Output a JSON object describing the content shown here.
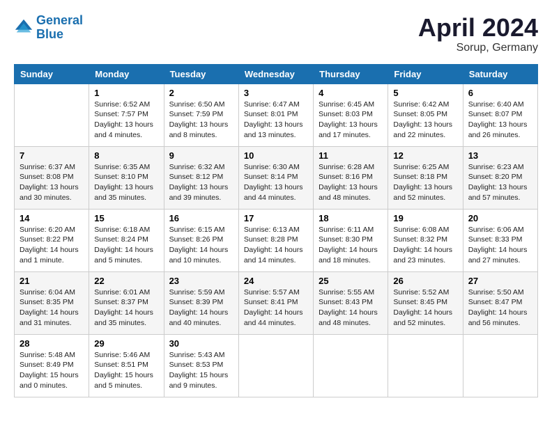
{
  "header": {
    "logo_line1": "General",
    "logo_line2": "Blue",
    "month_year": "April 2024",
    "location": "Sorup, Germany"
  },
  "days_of_week": [
    "Sunday",
    "Monday",
    "Tuesday",
    "Wednesday",
    "Thursday",
    "Friday",
    "Saturday"
  ],
  "weeks": [
    [
      {
        "day": "",
        "info": ""
      },
      {
        "day": "1",
        "info": "Sunrise: 6:52 AM\nSunset: 7:57 PM\nDaylight: 13 hours\nand 4 minutes."
      },
      {
        "day": "2",
        "info": "Sunrise: 6:50 AM\nSunset: 7:59 PM\nDaylight: 13 hours\nand 8 minutes."
      },
      {
        "day": "3",
        "info": "Sunrise: 6:47 AM\nSunset: 8:01 PM\nDaylight: 13 hours\nand 13 minutes."
      },
      {
        "day": "4",
        "info": "Sunrise: 6:45 AM\nSunset: 8:03 PM\nDaylight: 13 hours\nand 17 minutes."
      },
      {
        "day": "5",
        "info": "Sunrise: 6:42 AM\nSunset: 8:05 PM\nDaylight: 13 hours\nand 22 minutes."
      },
      {
        "day": "6",
        "info": "Sunrise: 6:40 AM\nSunset: 8:07 PM\nDaylight: 13 hours\nand 26 minutes."
      }
    ],
    [
      {
        "day": "7",
        "info": "Sunrise: 6:37 AM\nSunset: 8:08 PM\nDaylight: 13 hours\nand 30 minutes."
      },
      {
        "day": "8",
        "info": "Sunrise: 6:35 AM\nSunset: 8:10 PM\nDaylight: 13 hours\nand 35 minutes."
      },
      {
        "day": "9",
        "info": "Sunrise: 6:32 AM\nSunset: 8:12 PM\nDaylight: 13 hours\nand 39 minutes."
      },
      {
        "day": "10",
        "info": "Sunrise: 6:30 AM\nSunset: 8:14 PM\nDaylight: 13 hours\nand 44 minutes."
      },
      {
        "day": "11",
        "info": "Sunrise: 6:28 AM\nSunset: 8:16 PM\nDaylight: 13 hours\nand 48 minutes."
      },
      {
        "day": "12",
        "info": "Sunrise: 6:25 AM\nSunset: 8:18 PM\nDaylight: 13 hours\nand 52 minutes."
      },
      {
        "day": "13",
        "info": "Sunrise: 6:23 AM\nSunset: 8:20 PM\nDaylight: 13 hours\nand 57 minutes."
      }
    ],
    [
      {
        "day": "14",
        "info": "Sunrise: 6:20 AM\nSunset: 8:22 PM\nDaylight: 14 hours\nand 1 minute."
      },
      {
        "day": "15",
        "info": "Sunrise: 6:18 AM\nSunset: 8:24 PM\nDaylight: 14 hours\nand 5 minutes."
      },
      {
        "day": "16",
        "info": "Sunrise: 6:15 AM\nSunset: 8:26 PM\nDaylight: 14 hours\nand 10 minutes."
      },
      {
        "day": "17",
        "info": "Sunrise: 6:13 AM\nSunset: 8:28 PM\nDaylight: 14 hours\nand 14 minutes."
      },
      {
        "day": "18",
        "info": "Sunrise: 6:11 AM\nSunset: 8:30 PM\nDaylight: 14 hours\nand 18 minutes."
      },
      {
        "day": "19",
        "info": "Sunrise: 6:08 AM\nSunset: 8:32 PM\nDaylight: 14 hours\nand 23 minutes."
      },
      {
        "day": "20",
        "info": "Sunrise: 6:06 AM\nSunset: 8:33 PM\nDaylight: 14 hours\nand 27 minutes."
      }
    ],
    [
      {
        "day": "21",
        "info": "Sunrise: 6:04 AM\nSunset: 8:35 PM\nDaylight: 14 hours\nand 31 minutes."
      },
      {
        "day": "22",
        "info": "Sunrise: 6:01 AM\nSunset: 8:37 PM\nDaylight: 14 hours\nand 35 minutes."
      },
      {
        "day": "23",
        "info": "Sunrise: 5:59 AM\nSunset: 8:39 PM\nDaylight: 14 hours\nand 40 minutes."
      },
      {
        "day": "24",
        "info": "Sunrise: 5:57 AM\nSunset: 8:41 PM\nDaylight: 14 hours\nand 44 minutes."
      },
      {
        "day": "25",
        "info": "Sunrise: 5:55 AM\nSunset: 8:43 PM\nDaylight: 14 hours\nand 48 minutes."
      },
      {
        "day": "26",
        "info": "Sunrise: 5:52 AM\nSunset: 8:45 PM\nDaylight: 14 hours\nand 52 minutes."
      },
      {
        "day": "27",
        "info": "Sunrise: 5:50 AM\nSunset: 8:47 PM\nDaylight: 14 hours\nand 56 minutes."
      }
    ],
    [
      {
        "day": "28",
        "info": "Sunrise: 5:48 AM\nSunset: 8:49 PM\nDaylight: 15 hours\nand 0 minutes."
      },
      {
        "day": "29",
        "info": "Sunrise: 5:46 AM\nSunset: 8:51 PM\nDaylight: 15 hours\nand 5 minutes."
      },
      {
        "day": "30",
        "info": "Sunrise: 5:43 AM\nSunset: 8:53 PM\nDaylight: 15 hours\nand 9 minutes."
      },
      {
        "day": "",
        "info": ""
      },
      {
        "day": "",
        "info": ""
      },
      {
        "day": "",
        "info": ""
      },
      {
        "day": "",
        "info": ""
      }
    ]
  ]
}
